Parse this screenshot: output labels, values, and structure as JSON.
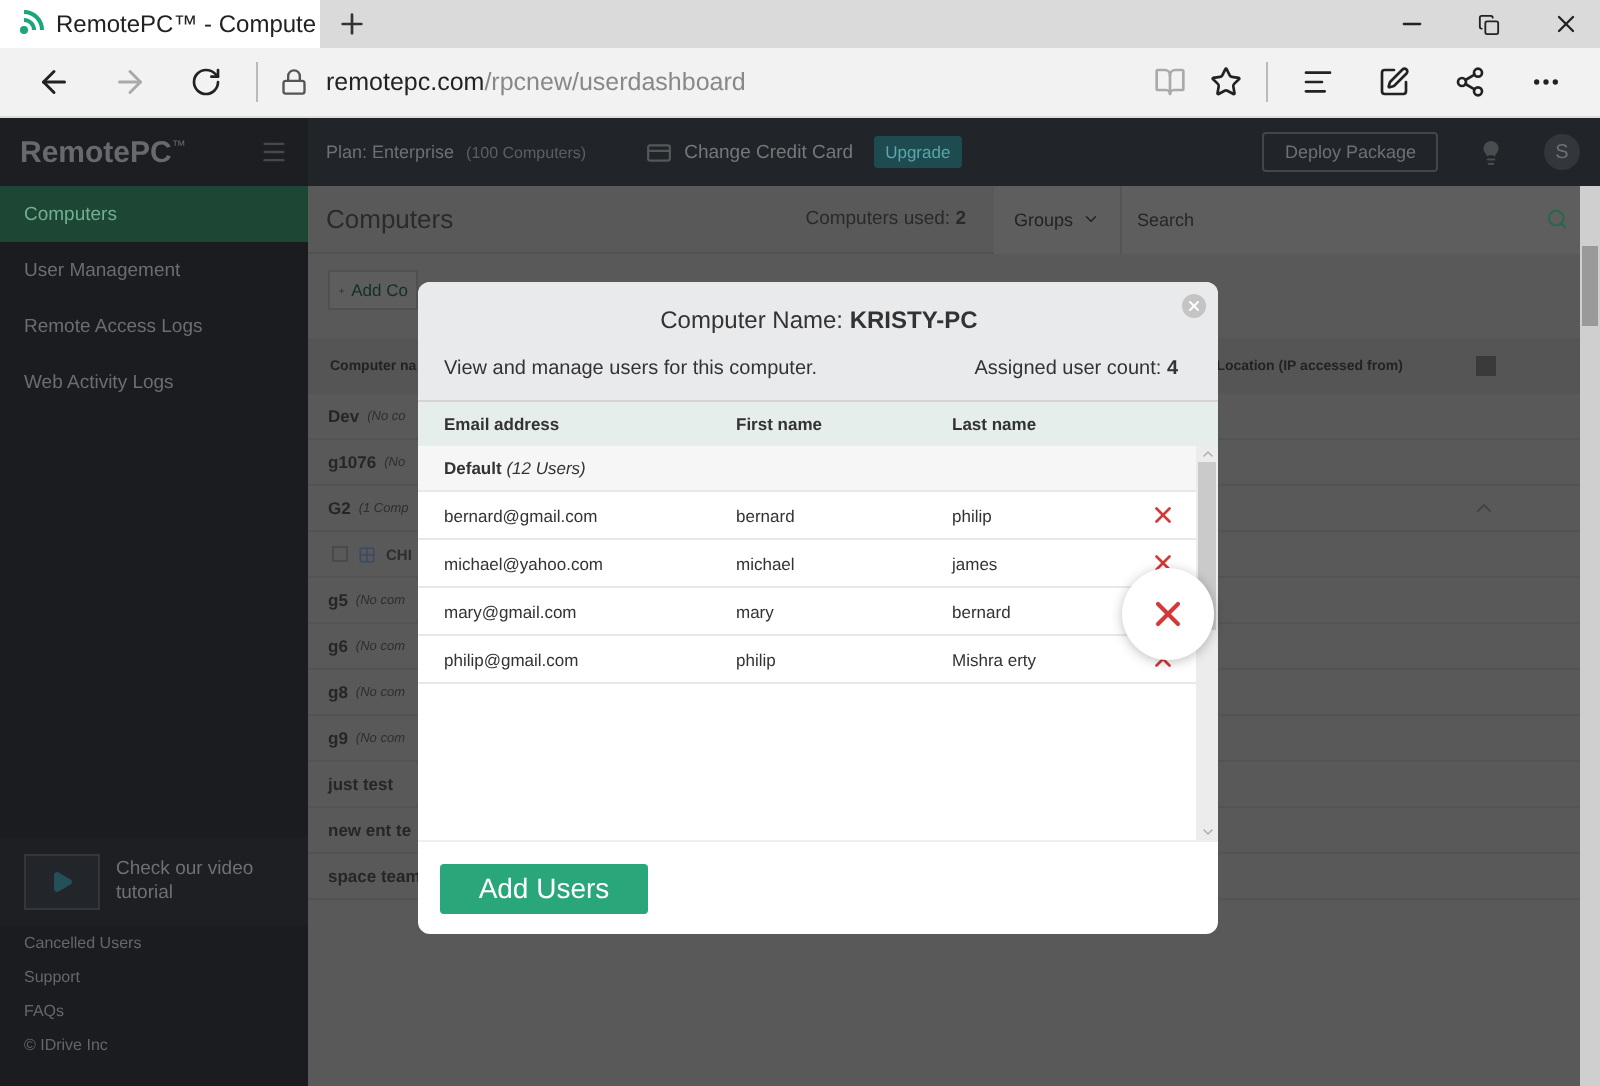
{
  "browser": {
    "tab_title": "RemotePC™ - Compute",
    "url_host": "remotepc.com",
    "url_path": "/rpcnew/userdashboard"
  },
  "sidebar": {
    "logo": "RemotePC",
    "logo_mark": "™",
    "items": [
      {
        "label": "Computers",
        "selected": true
      },
      {
        "label": "User Management",
        "selected": false
      },
      {
        "label": "Remote Access Logs",
        "selected": false
      },
      {
        "label": "Web Activity Logs",
        "selected": false
      }
    ],
    "video_tutorial": "Check our video tutorial",
    "footer_links": [
      "Cancelled Users",
      "Support",
      "FAQs",
      "© IDrive Inc"
    ]
  },
  "header": {
    "plan": "Plan: Enterprise",
    "plan_note": "(100 Computers)",
    "change_card": "Change Credit Card",
    "upgrade": "Upgrade",
    "deploy": "Deploy Package",
    "avatar": "S"
  },
  "computers": {
    "title": "Computers",
    "used": "Computers used: **2**",
    "groups": "Groups",
    "search_placeholder": "Search",
    "add_button": "Add Co",
    "columns": [
      "Computer na",
      "Location (IP accessed from)"
    ],
    "rows": [
      {
        "name": "Dev",
        "note": "(No co"
      },
      {
        "name": "g1076",
        "note": "(No"
      },
      {
        "name": "G2",
        "note": "(1 Comp",
        "expanded": true,
        "children": [
          {
            "name": "CHI",
            "checked": false
          }
        ]
      },
      {
        "name": "g5",
        "note": "(No com"
      },
      {
        "name": "g6",
        "note": "(No com"
      },
      {
        "name": "g8",
        "note": "(No com"
      },
      {
        "name": "g9",
        "note": "(No com"
      },
      {
        "name": "just test"
      },
      {
        "name": "new ent te"
      },
      {
        "name": "space team"
      }
    ]
  },
  "modal": {
    "title": "Computer Name: **KRISTY-PC**",
    "description": "View and manage users for this computer.",
    "count": "Assigned user count: **4**",
    "columns": [
      "Email address",
      "First name",
      "Last name"
    ],
    "group": "**Default** *(12 Users)*",
    "users": [
      {
        "email": "bernard@gmail.com",
        "first_name": "bernard",
        "last_name": "philip",
        "hovered": false
      },
      {
        "email": "michael@yahoo.com",
        "first_name": "michael",
        "last_name": "james",
        "hovered": false
      },
      {
        "email": "mary@gmail.com",
        "first_name": "mary",
        "last_name": "bernard",
        "hovered": true
      },
      {
        "email": "philip@gmail.com",
        "first_name": "philip",
        "last_name": "Mishra erty",
        "hovered": false
      }
    ],
    "add_button": "Add Users"
  }
}
